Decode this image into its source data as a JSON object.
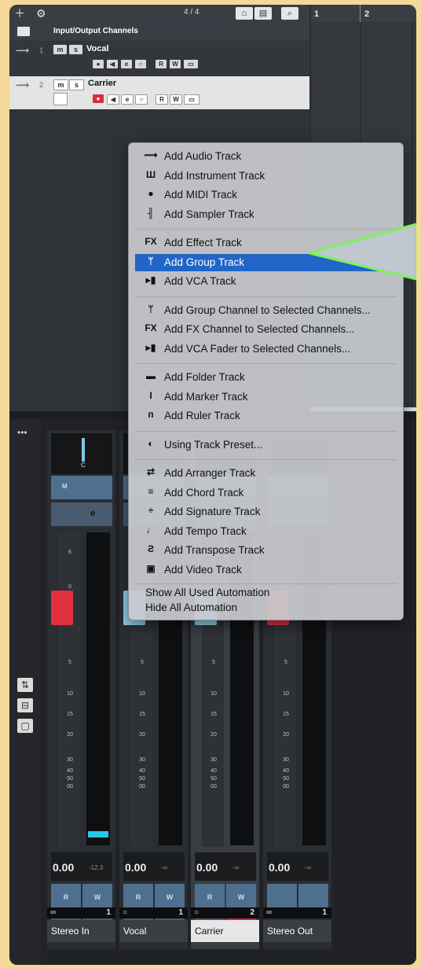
{
  "toolbar": {
    "add_icon": "plus-icon",
    "settings_icon": "track-settings-icon",
    "time_signature": "4 / 4",
    "buttons": [
      "home-icon",
      "layout-icon",
      "search-icon"
    ]
  },
  "ruler": {
    "markers": [
      "1",
      "2"
    ]
  },
  "tracklist": {
    "header": {
      "title": "Input/Output Channels"
    },
    "tracks": [
      {
        "number": "1",
        "name": "Vocal",
        "mute": "m",
        "solo": "s",
        "read": "R",
        "write": "W",
        "edit": "e"
      },
      {
        "number": "2",
        "name": "Carrier",
        "mute": "m",
        "solo": "s",
        "read": "R",
        "write": "W",
        "edit": "e"
      }
    ]
  },
  "menu": {
    "groups": [
      [
        {
          "icon": "audio-wave-icon",
          "glyph": "⟿",
          "label": "Add Audio Track"
        },
        {
          "icon": "instrument-icon",
          "glyph": "Ш",
          "label": "Add Instrument Track"
        },
        {
          "icon": "midi-icon",
          "glyph": "●",
          "label": "Add MIDI Track"
        },
        {
          "icon": "sampler-icon",
          "glyph": "╢",
          "label": "Add Sampler Track"
        }
      ],
      [
        {
          "icon": "fx-icon",
          "glyph": "FX",
          "label": "Add Effect Track"
        },
        {
          "icon": "group-icon",
          "glyph": "ᛘ",
          "label": "Add Group Track",
          "highlighted": true
        },
        {
          "icon": "vca-icon",
          "glyph": "▸▮",
          "label": "Add VCA Track"
        }
      ],
      [
        {
          "icon": "group-icon",
          "glyph": "ᛘ",
          "label": "Add Group Channel to Selected Channels..."
        },
        {
          "icon": "fx-icon",
          "glyph": "FX",
          "label": "Add FX Channel to Selected Channels..."
        },
        {
          "icon": "vca-icon",
          "glyph": "▸▮",
          "label": "Add VCA Fader to Selected Channels..."
        }
      ],
      [
        {
          "icon": "folder-icon",
          "glyph": "▬",
          "label": "Add Folder Track"
        },
        {
          "icon": "marker-icon",
          "glyph": "I",
          "label": "Add Marker Track"
        },
        {
          "icon": "ruler-icon",
          "glyph": "ᴨ",
          "label": "Add Ruler Track"
        }
      ],
      [
        {
          "icon": "track-preset-icon",
          "glyph": "◐",
          "label": "Using Track Preset..."
        }
      ],
      [
        {
          "icon": "arranger-icon",
          "glyph": "⇄",
          "label": "Add Arranger Track"
        },
        {
          "icon": "chord-icon",
          "glyph": "≡",
          "label": "Add Chord Track"
        },
        {
          "icon": "signature-icon",
          "glyph": "÷",
          "label": "Add Signature Track"
        },
        {
          "icon": "tempo-icon",
          "glyph": "♩",
          "label": "Add Tempo Track"
        },
        {
          "icon": "transpose-icon",
          "glyph": "Ƨ",
          "label": "Add Transpose Track"
        },
        {
          "icon": "video-icon",
          "glyph": "▣",
          "label": "Add Video Track"
        }
      ]
    ],
    "footer": [
      "Show All Used Automation",
      "Hide All Automation"
    ]
  },
  "mixer": {
    "left_buttons": [
      "mixer-faders-icon",
      "routing-icon",
      "inserts-icon"
    ],
    "fader_scale": [
      "6",
      "0",
      "5",
      "10",
      "15",
      "20",
      "30",
      "40",
      "50",
      "00"
    ],
    "strips": [
      {
        "name": "Stereo In",
        "volume": "0.00",
        "peak": "-12.3",
        "io_number": "1",
        "pan": "C",
        "mute": "M",
        "edit": "e",
        "read": "R",
        "write": "W",
        "cap_color": "#e0303e",
        "selected": false
      },
      {
        "name": "Vocal",
        "volume": "0.00",
        "peak": "-∞",
        "io_number": "1",
        "read": "R",
        "write": "W",
        "cap_color": "#8fd0ec",
        "selected": false
      },
      {
        "name": "Carrier",
        "volume": "0.00",
        "peak": "-∞",
        "io_number": "2",
        "read": "R",
        "write": "W",
        "cap_color": "#8fd0ec",
        "selected": true
      },
      {
        "name": "Stereo Out",
        "volume": "0.00",
        "peak": "-∞",
        "io_number": "1",
        "cap_color": "#e0303e",
        "selected": false
      }
    ]
  },
  "colors": {
    "highlight": "#2065c7",
    "record": "#d83040",
    "callout": "#7cf25a",
    "background": "#f3d89a"
  }
}
